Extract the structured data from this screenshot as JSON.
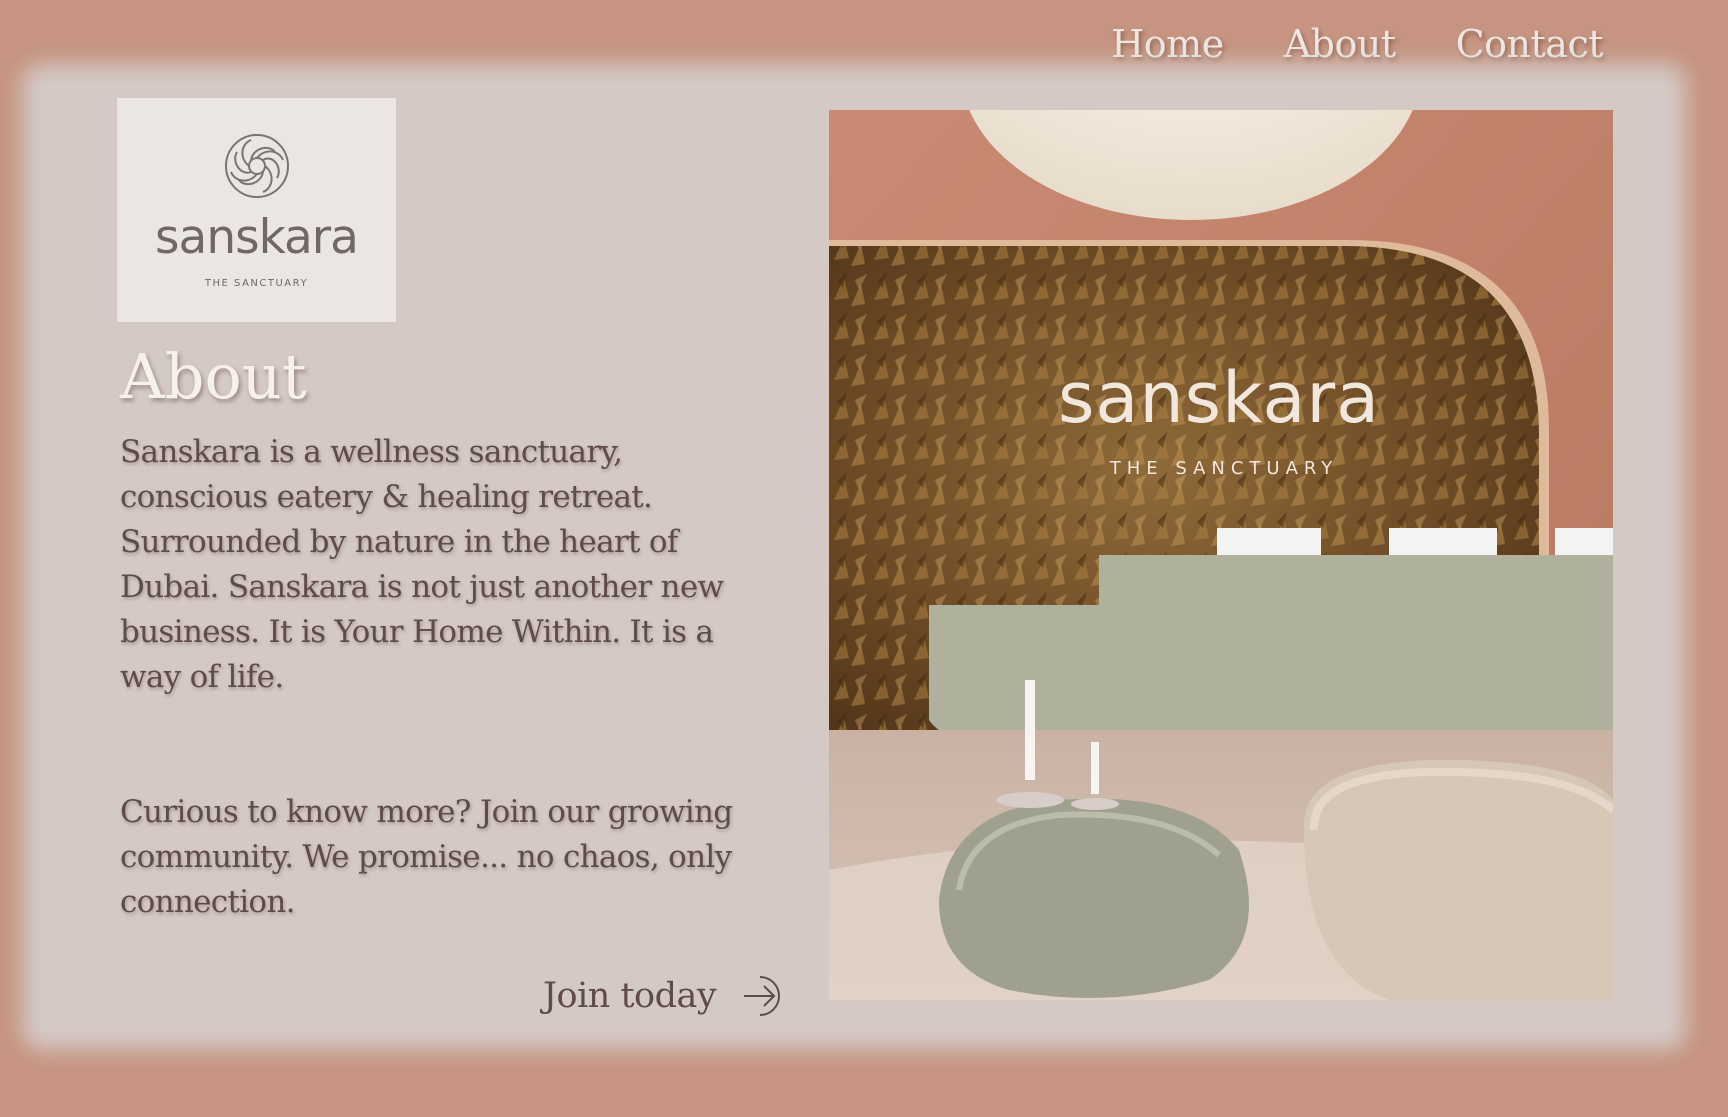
{
  "nav": {
    "items": [
      {
        "label": "Home"
      },
      {
        "label": "About"
      },
      {
        "label": "Contact"
      }
    ]
  },
  "logo": {
    "name": "sanskara",
    "tagline": "THE SANCTUARY",
    "icon": "flower-mandala-icon"
  },
  "about": {
    "title": "About",
    "paragraph": "Sanskara is a wellness sanctuary, conscious eatery & healing retreat. Surrounded by nature in the heart of Dubai. Sanskara is not just another new business. It is Your Home Within. It is a way of life.",
    "cta_text": "Curious to know more? Join our growing community. We promise... no chaos, only connection.",
    "join_label": "Join today",
    "join_icon": "arrow-right-circle-icon"
  },
  "photo": {
    "sign_name": "sanskara",
    "sign_tagline": "THE SANCTUARY"
  },
  "colors": {
    "background": "#c69480",
    "panel": "#d4c9c5",
    "logo_box": "#ebe6e3",
    "text": "#5e4b4a",
    "nav_text": "#efe6e2"
  }
}
